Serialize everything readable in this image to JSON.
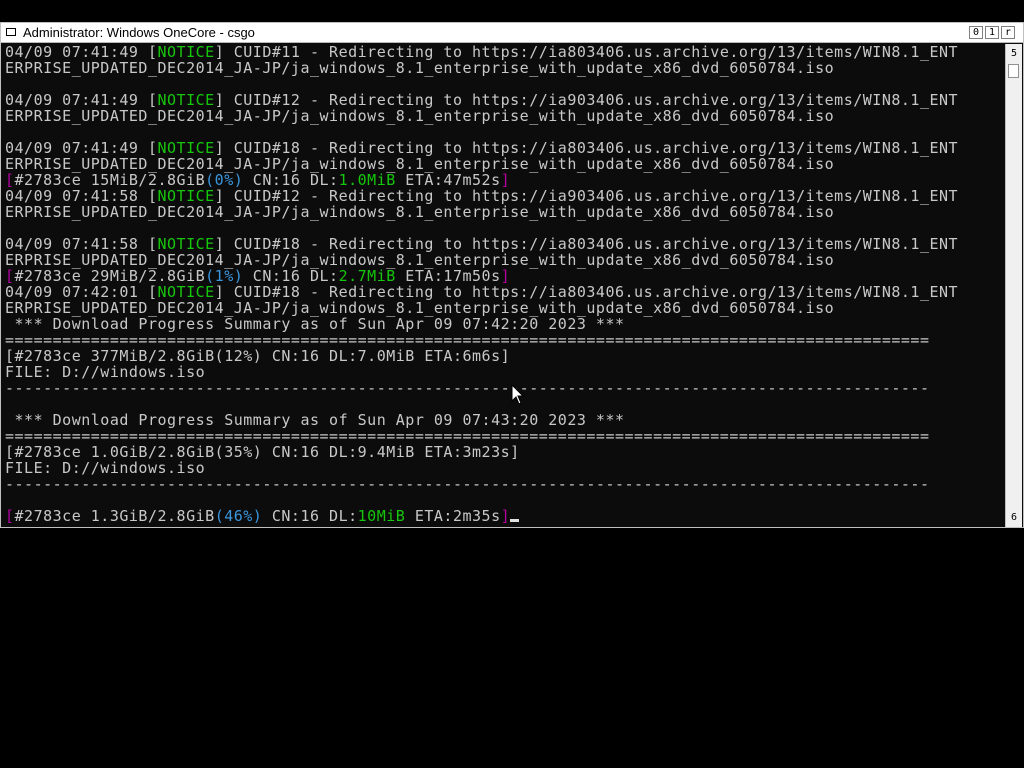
{
  "window": {
    "title": "Administrator:  Windows OneCore - csgo",
    "buttons": {
      "minimize": "0",
      "maximize": "1",
      "close": "r"
    }
  },
  "scrollbar": {
    "up_arrow": "5",
    "down_arrow": "6"
  },
  "console": {
    "lines": [
      [
        {
          "t": "04/09 07:41:49 [",
          "c": "gray"
        },
        {
          "t": "NOTICE",
          "c": "green"
        },
        {
          "t": "] CUID#11 - Redirecting to https://ia803406.us.archive.org/13/items/WIN8.1_ENT",
          "c": "gray"
        }
      ],
      [
        {
          "t": "ERPRISE_UPDATED_DEC2014_JA-JP/ja_windows_8.1_enterprise_with_update_x86_dvd_6050784.iso",
          "c": "gray"
        }
      ],
      [],
      [
        {
          "t": "04/09 07:41:49 [",
          "c": "gray"
        },
        {
          "t": "NOTICE",
          "c": "green"
        },
        {
          "t": "] CUID#12 - Redirecting to https://ia903406.us.archive.org/13/items/WIN8.1_ENT",
          "c": "gray"
        }
      ],
      [
        {
          "t": "ERPRISE_UPDATED_DEC2014_JA-JP/ja_windows_8.1_enterprise_with_update_x86_dvd_6050784.iso",
          "c": "gray"
        }
      ],
      [],
      [
        {
          "t": "04/09 07:41:49 [",
          "c": "gray"
        },
        {
          "t": "NOTICE",
          "c": "green"
        },
        {
          "t": "] CUID#18 - Redirecting to https://ia803406.us.archive.org/13/items/WIN8.1_ENT",
          "c": "gray"
        }
      ],
      [
        {
          "t": "ERPRISE_UPDATED_DEC2014_JA-JP/ja_windows_8.1_enterprise_with_update_x86_dvd_6050784.iso",
          "c": "gray"
        }
      ],
      [
        {
          "t": "[",
          "c": "purple"
        },
        {
          "t": "#2783ce 15MiB/2.8GiB",
          "c": "gray"
        },
        {
          "t": "(0%)",
          "c": "teal"
        },
        {
          "t": " CN:16 DL:",
          "c": "gray"
        },
        {
          "t": "1.0MiB",
          "c": "green"
        },
        {
          "t": " ETA:47m52s",
          "c": "gray"
        },
        {
          "t": "]",
          "c": "purple"
        }
      ],
      [
        {
          "t": "04/09 07:41:58 [",
          "c": "gray"
        },
        {
          "t": "NOTICE",
          "c": "green"
        },
        {
          "t": "] CUID#12 - Redirecting to https://ia903406.us.archive.org/13/items/WIN8.1_ENT",
          "c": "gray"
        }
      ],
      [
        {
          "t": "ERPRISE_UPDATED_DEC2014_JA-JP/ja_windows_8.1_enterprise_with_update_x86_dvd_6050784.iso",
          "c": "gray"
        }
      ],
      [],
      [
        {
          "t": "04/09 07:41:58 [",
          "c": "gray"
        },
        {
          "t": "NOTICE",
          "c": "green"
        },
        {
          "t": "] CUID#18 - Redirecting to https://ia803406.us.archive.org/13/items/WIN8.1_ENT",
          "c": "gray"
        }
      ],
      [
        {
          "t": "ERPRISE_UPDATED_DEC2014_JA-JP/ja_windows_8.1_enterprise_with_update_x86_dvd_6050784.iso",
          "c": "gray"
        }
      ],
      [
        {
          "t": "[",
          "c": "purple"
        },
        {
          "t": "#2783ce 29MiB/2.8GiB",
          "c": "gray"
        },
        {
          "t": "(1%)",
          "c": "teal"
        },
        {
          "t": " CN:16 DL:",
          "c": "gray"
        },
        {
          "t": "2.7MiB",
          "c": "green"
        },
        {
          "t": " ETA:17m50s",
          "c": "gray"
        },
        {
          "t": "]",
          "c": "purple"
        }
      ],
      [
        {
          "t": "04/09 07:42:01 [",
          "c": "gray"
        },
        {
          "t": "NOTICE",
          "c": "green"
        },
        {
          "t": "] CUID#18 - Redirecting to https://ia803406.us.archive.org/13/items/WIN8.1_ENT",
          "c": "gray"
        }
      ],
      [
        {
          "t": "ERPRISE_UPDATED_DEC2014_JA-JP/ja_windows_8.1_enterprise_with_update_x86_dvd_6050784.iso",
          "c": "gray"
        }
      ],
      [
        {
          "t": " *** Download Progress Summary as of Sun Apr 09 07:42:20 2023 ***",
          "c": "gray"
        }
      ],
      [
        {
          "t": "=================================================================================================",
          "c": "gray"
        }
      ],
      [
        {
          "t": "[#2783ce 377MiB/2.8GiB(12%) CN:16 DL:7.0MiB ETA:6m6s]",
          "c": "gray"
        }
      ],
      [
        {
          "t": "FILE: D://windows.iso",
          "c": "gray"
        }
      ],
      [
        {
          "t": "-------------------------------------------------------------------------------------------------",
          "c": "gray"
        }
      ],
      [],
      [
        {
          "t": " *** Download Progress Summary as of Sun Apr 09 07:43:20 2023 ***",
          "c": "gray"
        }
      ],
      [
        {
          "t": "=================================================================================================",
          "c": "gray"
        }
      ],
      [
        {
          "t": "[#2783ce 1.0GiB/2.8GiB(35%) CN:16 DL:9.4MiB ETA:3m23s]",
          "c": "gray"
        }
      ],
      [
        {
          "t": "FILE: D://windows.iso",
          "c": "gray"
        }
      ],
      [
        {
          "t": "-------------------------------------------------------------------------------------------------",
          "c": "gray"
        }
      ],
      [],
      [
        {
          "t": "[",
          "c": "purple"
        },
        {
          "t": "#2783ce 1.3GiB/2.8GiB",
          "c": "gray"
        },
        {
          "t": "(46%)",
          "c": "teal"
        },
        {
          "t": " CN:16 DL:",
          "c": "gray"
        },
        {
          "t": "10MiB",
          "c": "green"
        },
        {
          "t": " ETA:2m35s",
          "c": "gray"
        },
        {
          "t": "]",
          "c": "purple"
        }
      ]
    ]
  },
  "colors": {
    "background": "#0c0c0c",
    "text": "#c8c8c8",
    "notice_green": "#16c60c",
    "percent_teal": "#3a96dd",
    "bracket_purple": "#b4009e"
  },
  "icons": {
    "window_icon": "console-window-icon",
    "mouse": "arrow-pointer-icon"
  }
}
